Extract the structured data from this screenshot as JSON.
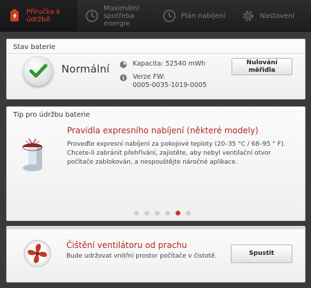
{
  "nav": {
    "tabs": [
      {
        "label_1": "Příručka k",
        "label_2": "údržbě",
        "icon": "battery-care-icon",
        "active": true
      },
      {
        "label_1": "Maximální",
        "label_2": "spotřeba",
        "label_3": "energie",
        "icon": "energy-icon",
        "active": false
      },
      {
        "label_1": "Plán nabíjení",
        "icon": "clock-icon",
        "active": false
      },
      {
        "label_1": "Nastavení",
        "icon": "gear-icon",
        "active": false
      }
    ]
  },
  "battery_status": {
    "title": "Stav baterie",
    "state": "Normální",
    "capacity": "Kapacita: 52540 mWh",
    "fw_label": "Verze FW:",
    "fw_value": "0005-0035-1019-0005",
    "reset_label_1": "Nulování",
    "reset_label_2": "měřidla"
  },
  "tip": {
    "section_title": "Tip pro údržbu baterie",
    "title": "Pravidla expresního nabíjení (některé modely)",
    "body": "Proveďte expresní nabíjení za pokojové teploty (20–35 °C / 68–95 ° F). Chcete-li zabránit přehřívání, zajistěte, aby nebyl ventilační otvor počítače zablokován, a nespouštějte náročné aplikace.",
    "page_count": 6,
    "active_page": 5
  },
  "fan": {
    "title": "Čištění ventilátoru od prachu",
    "body": "Bude udržovat vnitřní prostor počítače v čistotě.",
    "run_label": "Spustit"
  },
  "colors": {
    "accent": "#c0392b",
    "nav_bg": "#1e1e1e",
    "nav_text": "#7c7c7c"
  }
}
